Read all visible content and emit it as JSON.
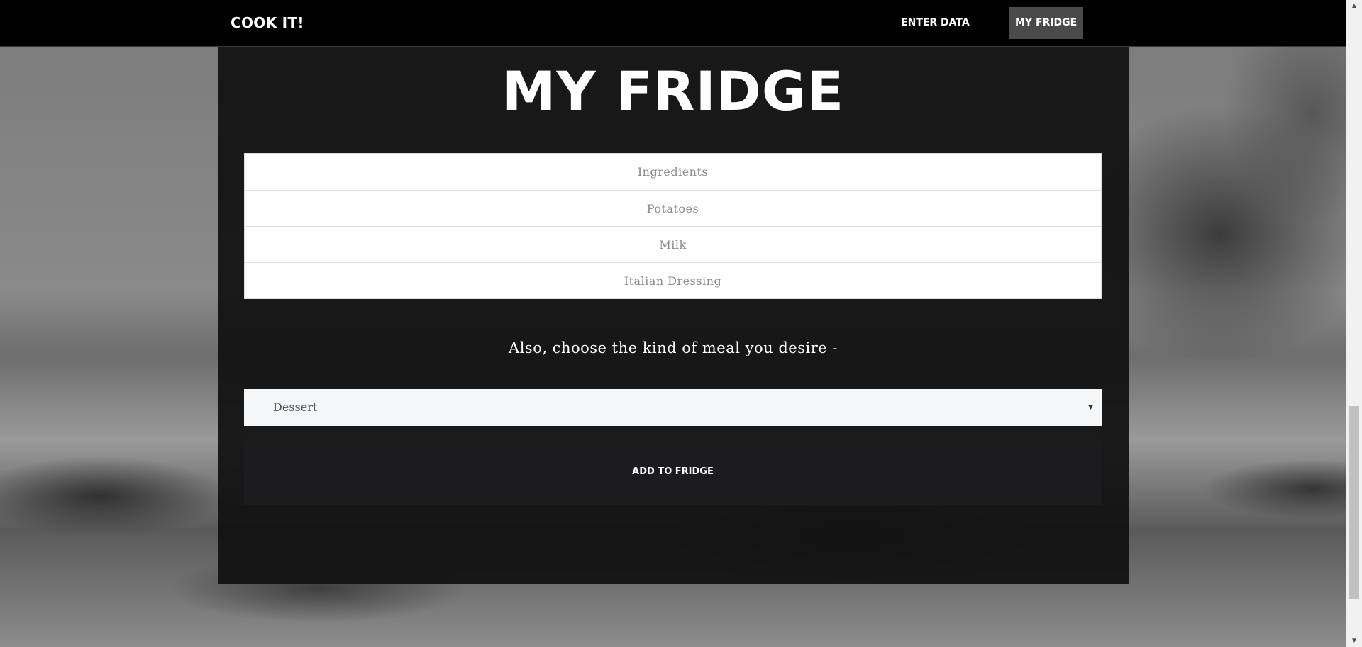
{
  "navbar": {
    "brand": "COOK IT!",
    "items": [
      {
        "label": "ENTER DATA",
        "active": false
      },
      {
        "label": "MY FRIDGE",
        "active": true
      }
    ]
  },
  "main": {
    "title": "MY FRIDGE",
    "list": [
      "Ingredients",
      "Potatoes",
      "Milk",
      "Italian Dressing"
    ],
    "prompt": "Also, choose the kind of meal you desire -",
    "meal_select": {
      "value": "Dessert"
    },
    "button_label": "ADD TO FRIDGE"
  },
  "colors": {
    "navbar_bg": "#000000",
    "active_nav_bg": "#4a4a4a",
    "panel_bg": "#101010",
    "button_bg": "#1c1c1e"
  },
  "icons": {
    "select_arrow": "caret-down-icon",
    "scroll_up": "arrow-up-icon",
    "scroll_down": "arrow-down-icon"
  }
}
